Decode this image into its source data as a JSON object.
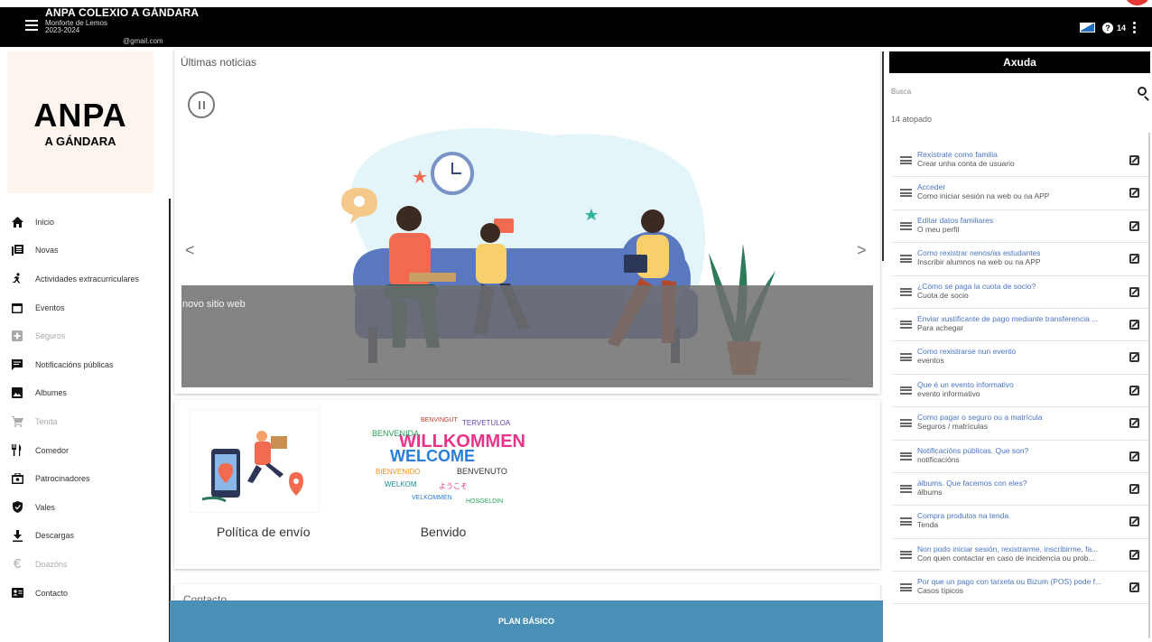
{
  "header": {
    "title": "ANPA COLEXIO A GÁNDARA",
    "location": "Monforte de Lemos",
    "year": "2023-2024",
    "email_suffix": "@gmail.com",
    "help_count": "14"
  },
  "logo": {
    "main": "ANPA",
    "sub": "A GÁNDARA"
  },
  "sidebar": {
    "items": [
      {
        "label": "Inicio",
        "icon": "home-icon",
        "disabled": false
      },
      {
        "label": "Novas",
        "icon": "news-icon",
        "disabled": false
      },
      {
        "label": "Actividades extracurriculares",
        "icon": "running-icon",
        "disabled": false
      },
      {
        "label": "Eventos",
        "icon": "calendar-icon",
        "disabled": false
      },
      {
        "label": "Seguros",
        "icon": "medical-icon",
        "disabled": true
      },
      {
        "label": "Notificacións públicas",
        "icon": "message-icon",
        "disabled": false
      },
      {
        "label": "Albumes",
        "icon": "photo-icon",
        "disabled": false
      },
      {
        "label": "Tenda",
        "icon": "cart-icon",
        "disabled": true
      },
      {
        "label": "Comedor",
        "icon": "utensils-icon",
        "disabled": false
      },
      {
        "label": "Patrocinadores",
        "icon": "sponsor-icon",
        "disabled": false
      },
      {
        "label": "Vales",
        "icon": "shield-icon",
        "disabled": false
      },
      {
        "label": "Descargas",
        "icon": "download-icon",
        "disabled": false
      },
      {
        "label": "Doazóns",
        "icon": "euro-icon",
        "disabled": true
      },
      {
        "label": "Contacto",
        "icon": "contact-card-icon",
        "disabled": false
      }
    ]
  },
  "main": {
    "news_title": "Últimas noticias",
    "slide_caption": "novo sitio web",
    "prev_arrow": "<",
    "next_arrow": ">",
    "links": [
      {
        "label": "Política de envío"
      },
      {
        "label": "Benvido"
      }
    ],
    "contact_title": "Contacto",
    "plan_label": "PLAN BÁSICO"
  },
  "help": {
    "title": "Axuda",
    "search_placeholder": "Busca",
    "found": "14 atopado",
    "items": [
      {
        "title": "Rexístrate como familia",
        "sub": "Crear unha conta de usuario"
      },
      {
        "title": "Acceder",
        "sub": "Como iniciar sesión na web ou na APP"
      },
      {
        "title": "Editar datos familiares",
        "sub": "O meu perfil"
      },
      {
        "title": "Como rexistrar nenos/as estudantes",
        "sub": "Inscribir alumnos na web ou na APP"
      },
      {
        "title": "¿Cómo se paga la cuota de socio?",
        "sub": "Cuota de socio"
      },
      {
        "title": "Enviar xustificante de pago mediante transferencia ...",
        "sub": "Para achegar"
      },
      {
        "title": "Como rexistrarse nun evento",
        "sub": "eventos"
      },
      {
        "title": "Que é un evento informativo",
        "sub": "evento informativo"
      },
      {
        "title": "Como pagar o seguro ou a matrícula",
        "sub": "Seguros / matrículas"
      },
      {
        "title": "Notificacións públicas. Que son?",
        "sub": "notificacións"
      },
      {
        "title": "álbums. Que facemos con eles?",
        "sub": "álbums"
      },
      {
        "title": "Compra produtos na tenda",
        "sub": "Tenda"
      },
      {
        "title": "Non podo iniciar sesión, rexistrarme, inscribirme, fa...",
        "sub": "Con quen contactar en caso de incidencia ou prob..."
      },
      {
        "title": "Por que un pago con tarxeta ou Bizum (POS) pode f...",
        "sub": "Casos típicos"
      }
    ]
  }
}
